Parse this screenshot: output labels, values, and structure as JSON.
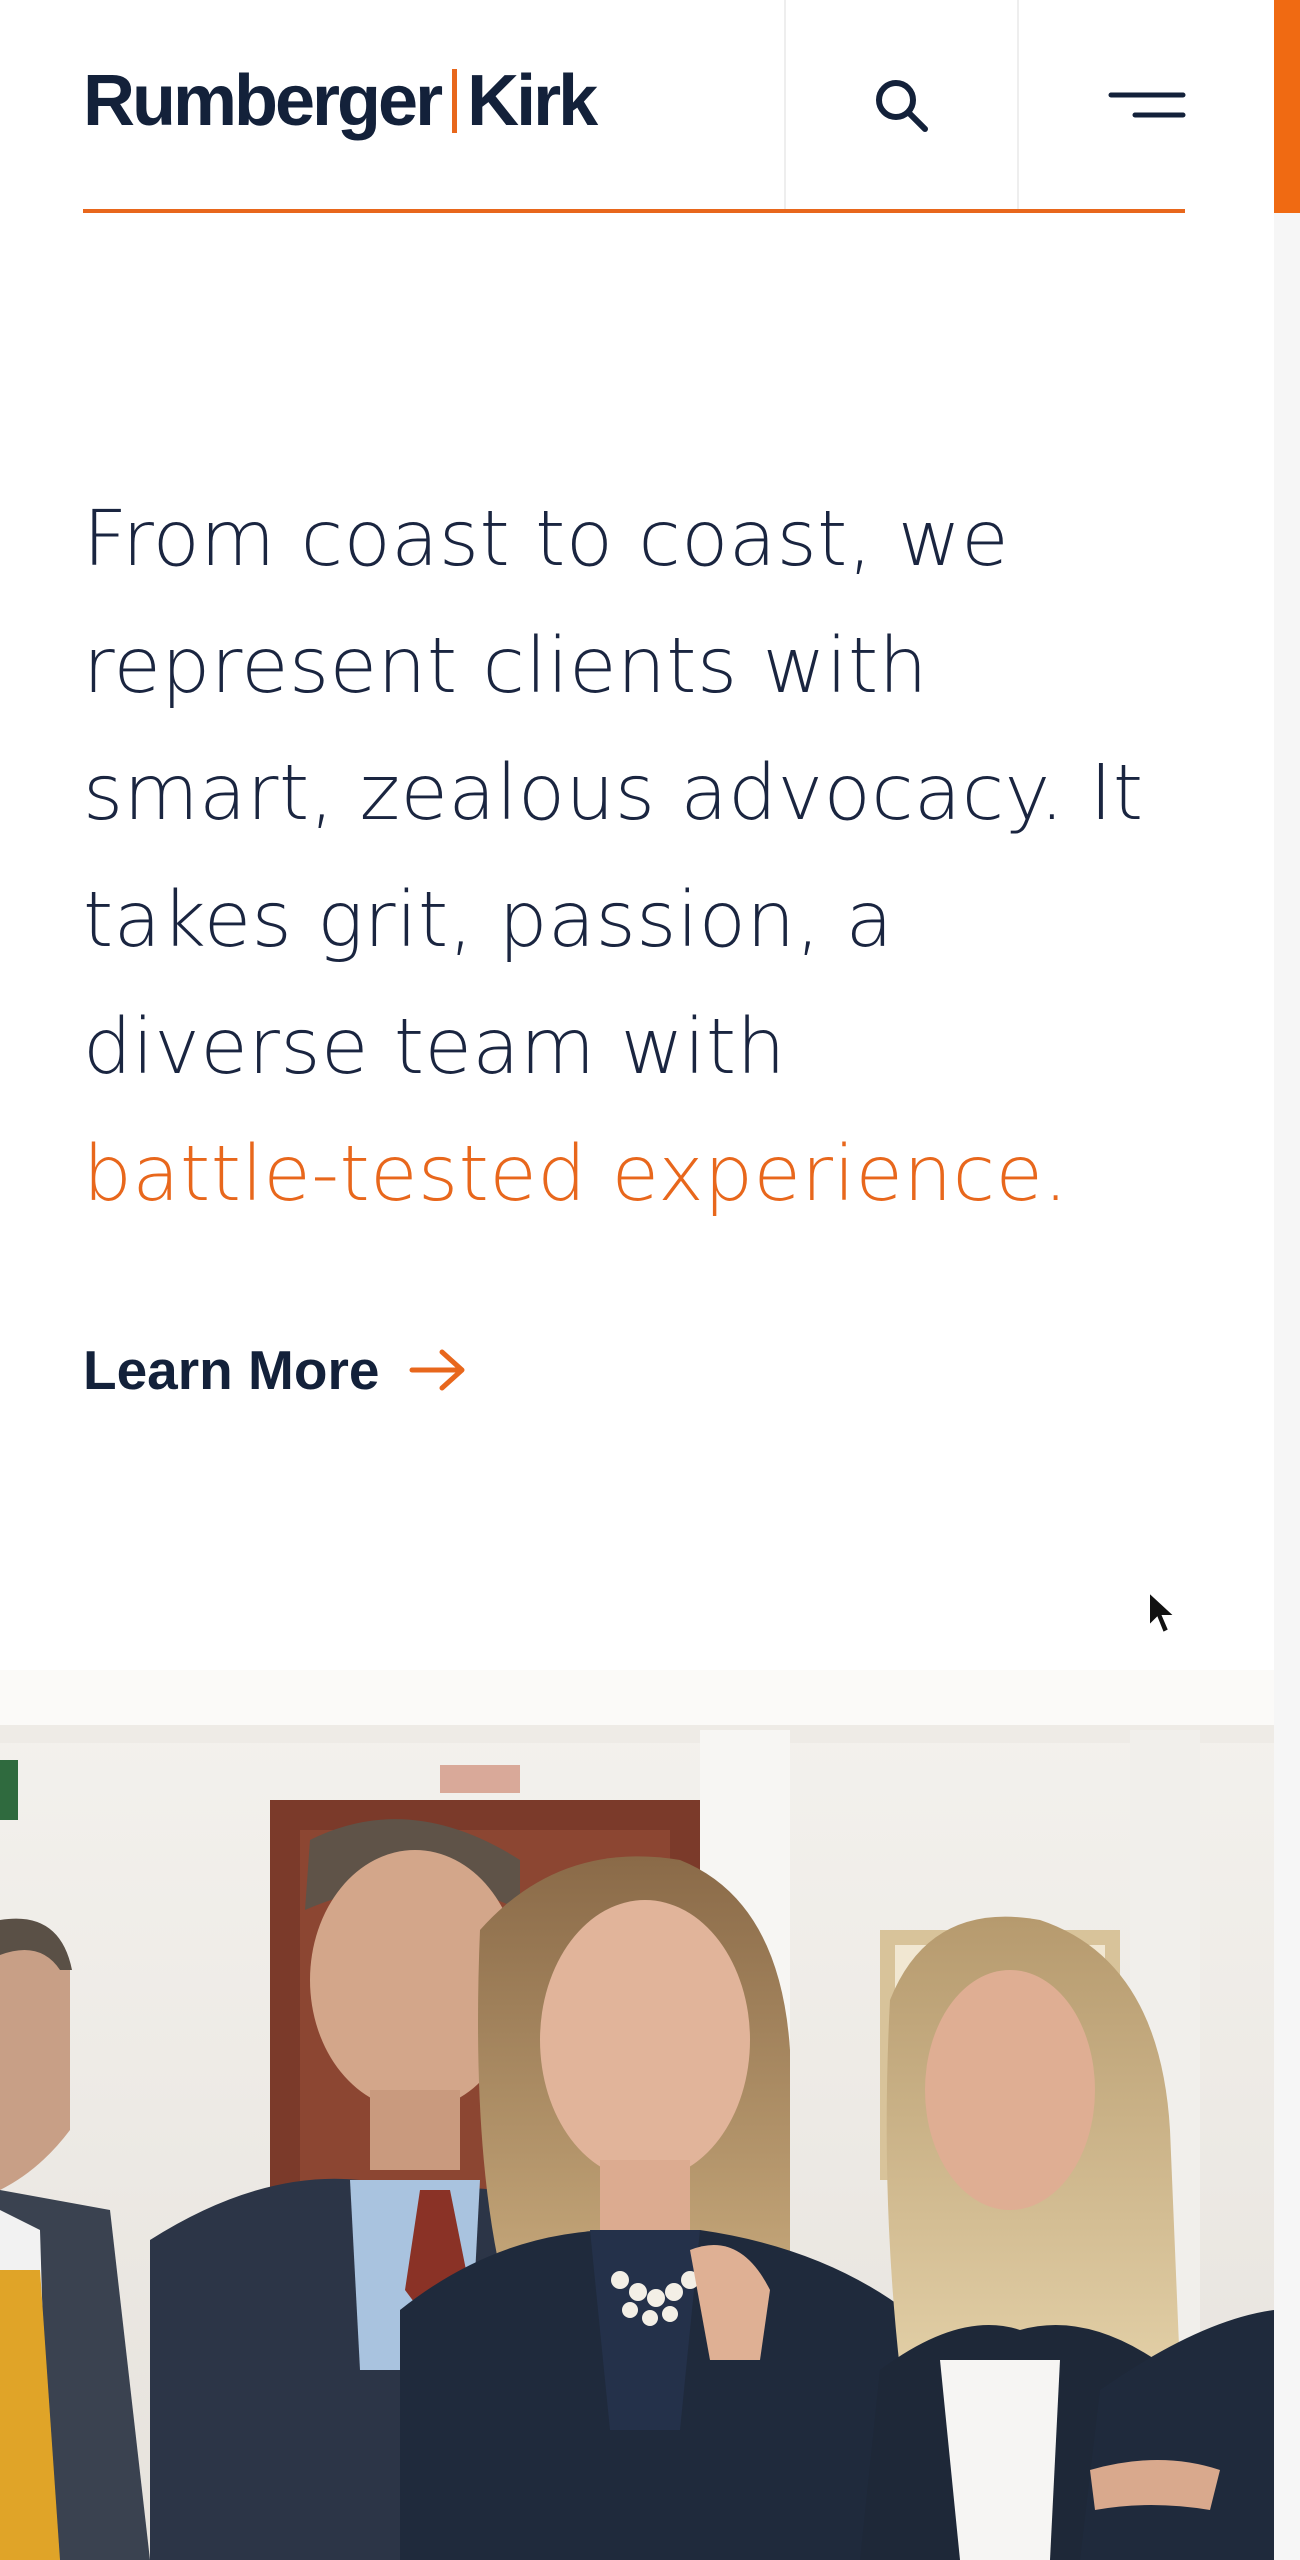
{
  "header": {
    "logo": {
      "part1": "Rumberger",
      "part2": "Kirk"
    },
    "search_icon": "search-icon",
    "menu_icon": "hamburger-menu-icon"
  },
  "colors": {
    "accent": "#e8671c",
    "navy": "#13213a",
    "scrollbar_thumb": "#f06a12"
  },
  "hero": {
    "text": "From coast to coast, we represent clients with smart, zealous advocacy. It takes grit, passion, a diverse team with",
    "accent_text": "battle-tested experience."
  },
  "cta": {
    "label": "Learn More",
    "icon": "arrow-right-icon"
  },
  "photo": {
    "description_icon": "team-photo"
  }
}
